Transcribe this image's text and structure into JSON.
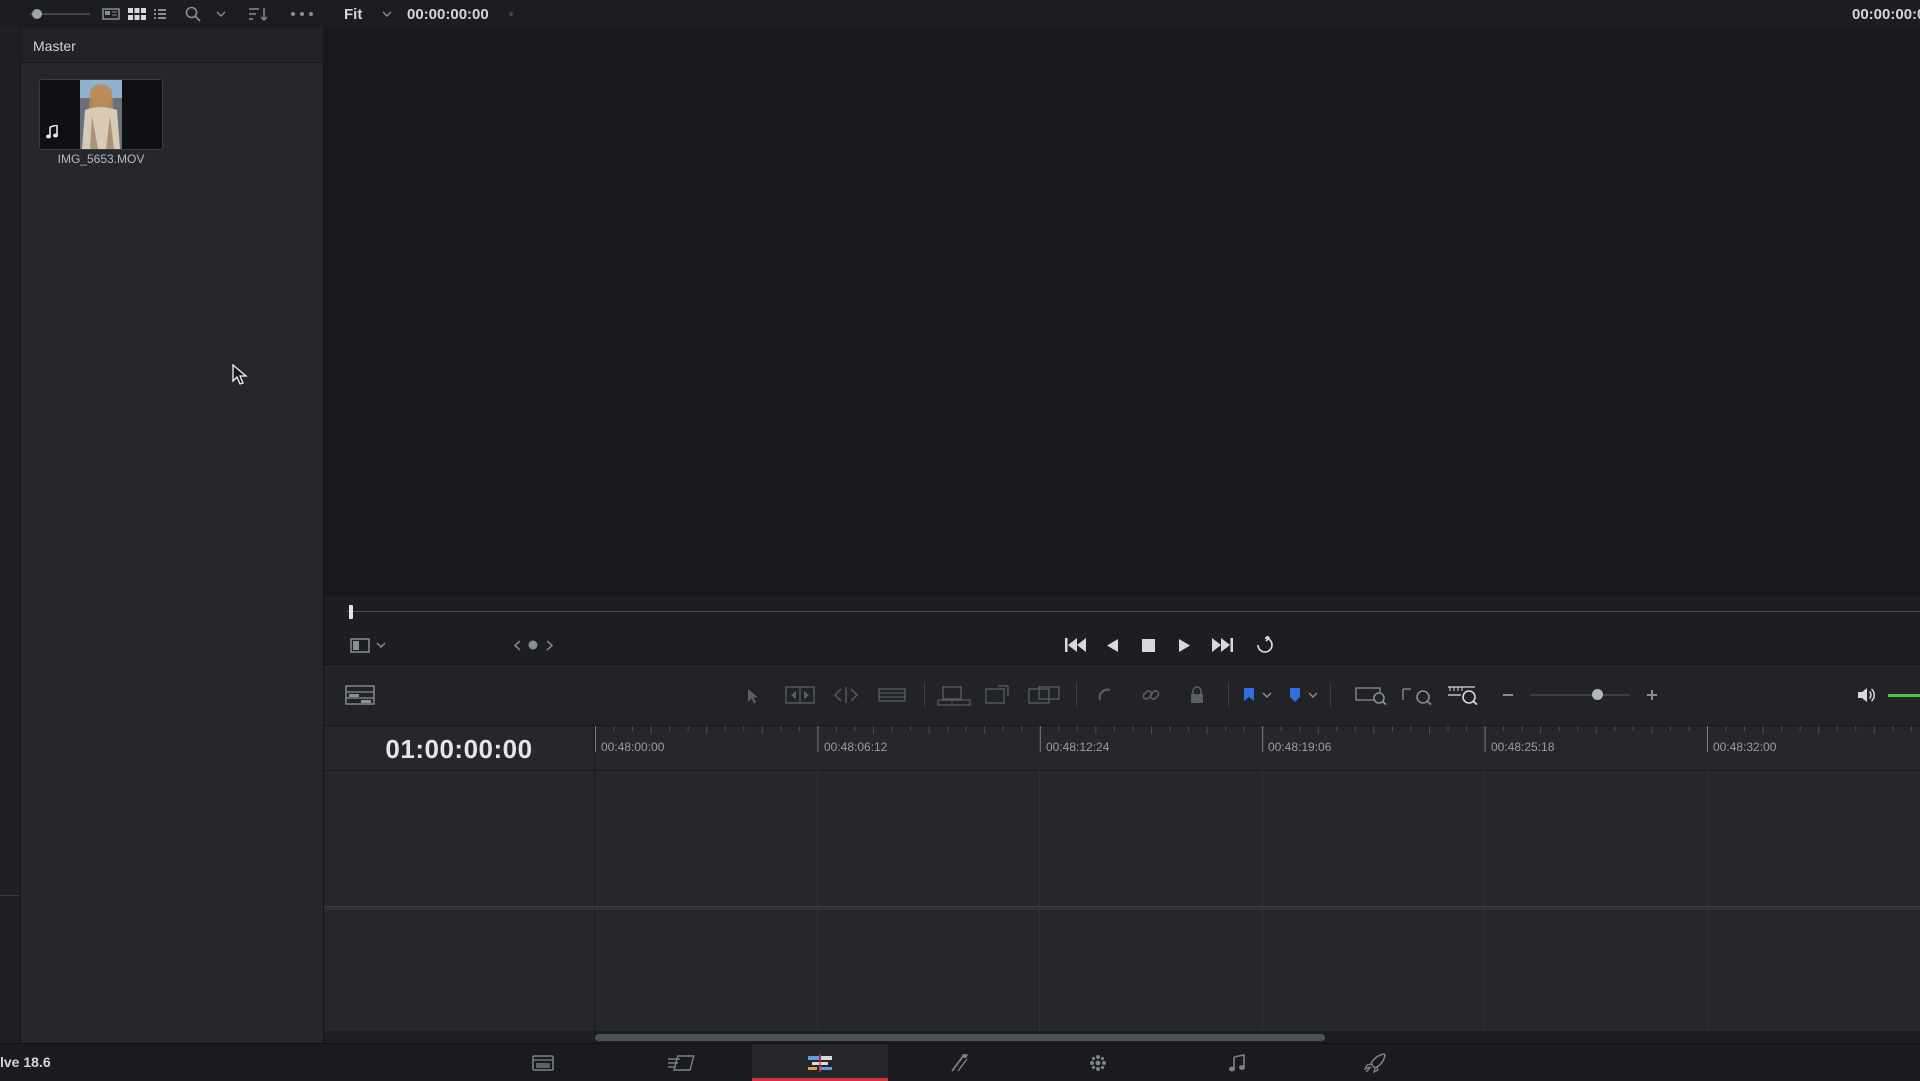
{
  "topbar": {
    "zoom_mode": "Fit",
    "source_timecode": "00:00:00:00",
    "record_timecode": "00:00:00:0"
  },
  "media_pool": {
    "bin_title": "Master",
    "clips": [
      {
        "name": "IMG_5653.MOV"
      }
    ]
  },
  "timeline": {
    "timecode": "01:00:00:00",
    "ruler_labels": [
      "00:48:00:00",
      "00:48:06:12",
      "00:48:12:24",
      "00:48:19:06",
      "00:48:25:18",
      "00:48:32:00"
    ],
    "zoom_level": 0.67
  },
  "footer": {
    "app_name": "lve 18.6"
  },
  "colors": {
    "accent": "#d9323f",
    "flag": "#2f6fdc",
    "volume": "#4cc44a"
  }
}
